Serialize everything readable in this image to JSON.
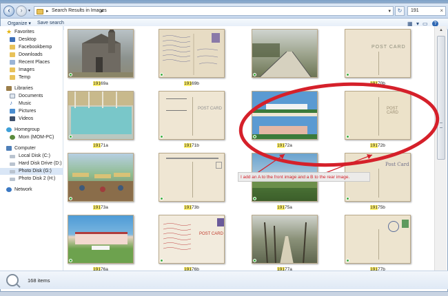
{
  "window": {
    "breadcrumb_label": "Search Results in Images",
    "search_query": "191"
  },
  "toolbar": {
    "organize_label": "Organize ▾",
    "save_search_label": "Save search"
  },
  "sidebar": {
    "favorites_header": "Favorites",
    "favorites": [
      "Desktop",
      "Facebookbemp",
      "Downloads",
      "Recent Places",
      "Images",
      "Temp"
    ],
    "libraries_header": "Libraries",
    "libraries": [
      "Documents",
      "Music",
      "Pictures",
      "Videos"
    ],
    "homegroup_header": "Homegroup",
    "homegroup": [
      "Mom (MOM-PC)"
    ],
    "computer_header": "Computer",
    "drives": [
      "Local Disk (C:)",
      "Hard Disk Drive (D:)",
      "Photo Disk (G:)",
      "Photo Disk 2 (H:)"
    ],
    "network_header": "Network"
  },
  "files": [
    {
      "highlight": "191",
      "rest": "69a"
    },
    {
      "highlight": "191",
      "rest": "69b"
    },
    {
      "highlight": "",
      "rest": ""
    },
    {
      "highlight": "191",
      "rest": "70b"
    },
    {
      "highlight": "191",
      "rest": "71a"
    },
    {
      "highlight": "191",
      "rest": "71b"
    },
    {
      "highlight": "191",
      "rest": "72a"
    },
    {
      "highlight": "191",
      "rest": "72b"
    },
    {
      "highlight": "191",
      "rest": "73a"
    },
    {
      "highlight": "191",
      "rest": "73b"
    },
    {
      "highlight": "191",
      "rest": "75a"
    },
    {
      "highlight": "191",
      "rest": "75b"
    },
    {
      "highlight": "191",
      "rest": "76a"
    },
    {
      "highlight": "191",
      "rest": "76b"
    },
    {
      "highlight": "191",
      "rest": "77a"
    },
    {
      "highlight": "191",
      "rest": "77b"
    }
  ],
  "postcard_words": {
    "post_card": "POST CARD",
    "post_card_script": "Post Card"
  },
  "status": {
    "item_count": "168 items"
  },
  "annotation": {
    "text": "I add an A to the front image and a B to the rear image.",
    "color": "#d5202a"
  }
}
